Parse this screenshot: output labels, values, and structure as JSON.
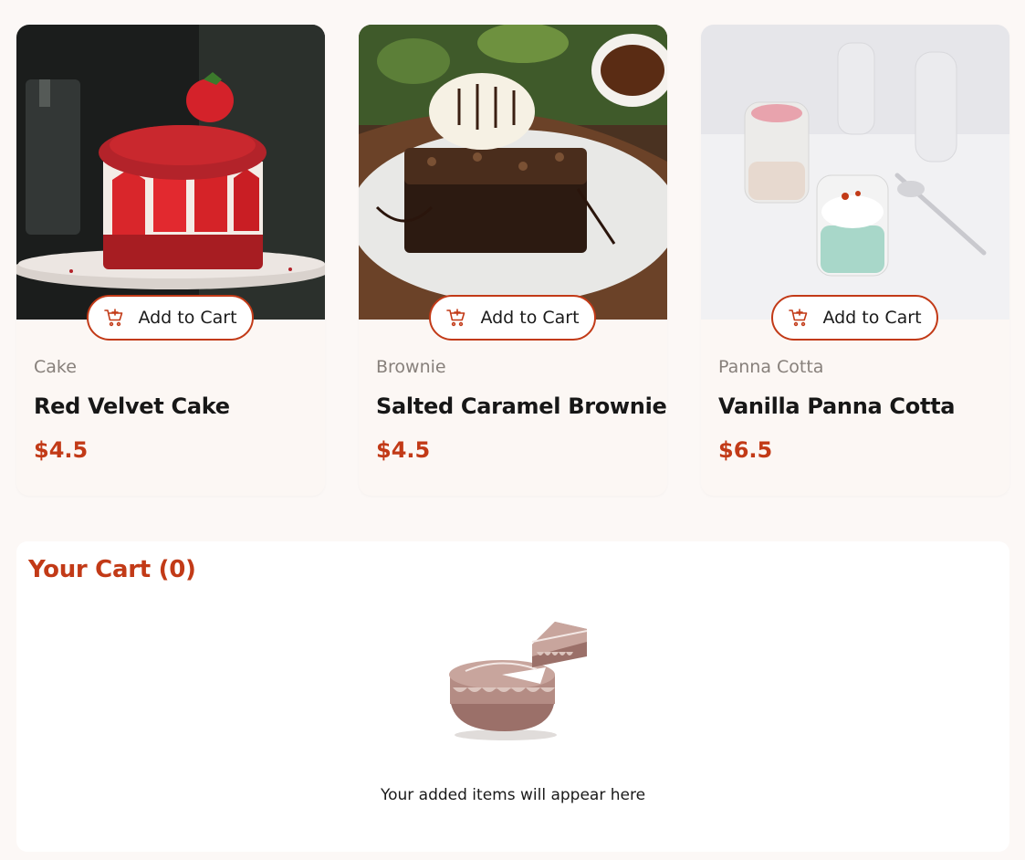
{
  "products": [
    {
      "category": "Cake",
      "name": "Red Velvet Cake",
      "price": "$4.5",
      "add_label": "Add to Cart",
      "image": "red-velvet-cake-photo"
    },
    {
      "category": "Brownie",
      "name": "Salted Caramel Brownie",
      "price": "$4.5",
      "add_label": "Add to Cart",
      "image": "brownie-photo"
    },
    {
      "category": "Panna Cotta",
      "name": "Vanilla Panna Cotta",
      "price": "$6.5",
      "add_label": "Add to Cart",
      "image": "panna-cotta-photo"
    }
  ],
  "cart": {
    "title": "Your Cart (0)",
    "empty_message": "Your added items will appear here",
    "illustration": "empty-cart-cake-illustration"
  },
  "colors": {
    "accent": "#c23a17",
    "page_bg": "#fcf8f6",
    "card_bg": "#fcf7f4",
    "muted_text": "#87807b"
  },
  "icons": {
    "add_to_cart": "cart-plus-icon"
  }
}
